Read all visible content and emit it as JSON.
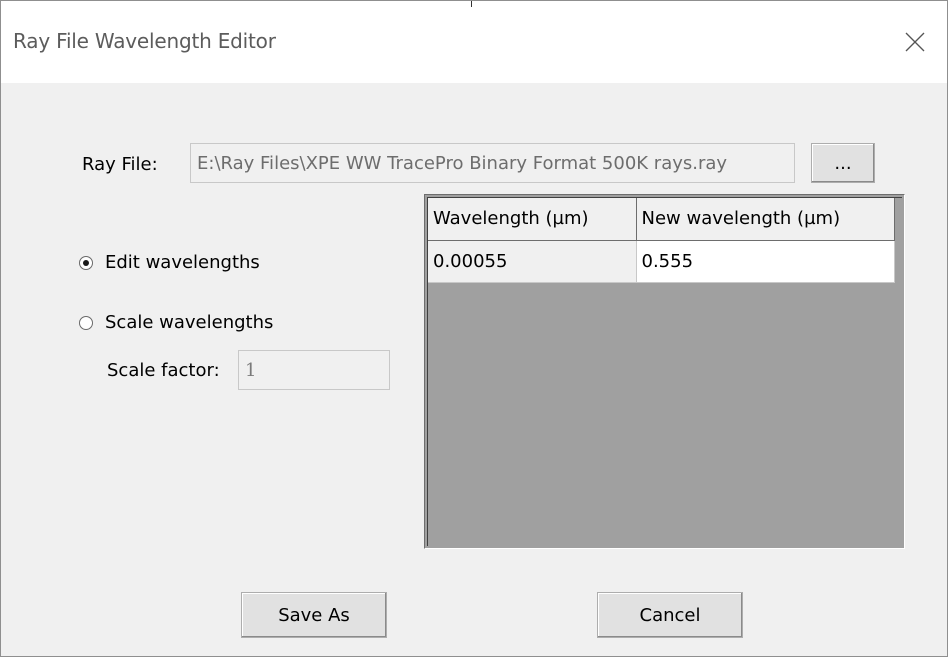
{
  "window": {
    "title": "Ray File Wavelength Editor",
    "close_icon": "close-icon"
  },
  "ray_file": {
    "label": "Ray File:",
    "value": "E:\\Ray Files\\XPE WW TracePro Binary Format 500K rays.ray",
    "browse_label": "..."
  },
  "mode": {
    "edit_label": "Edit wavelengths",
    "edit_selected": true,
    "scale_label": "Scale wavelengths",
    "scale_selected": false,
    "scale_factor_label": "Scale factor:",
    "scale_factor_value": "1"
  },
  "table": {
    "columns": [
      "Wavelength (µm)",
      "New wavelength (µm)"
    ],
    "rows": [
      [
        "0.00055",
        "0.555"
      ]
    ]
  },
  "buttons": {
    "save_as": "Save As",
    "cancel": "Cancel"
  }
}
